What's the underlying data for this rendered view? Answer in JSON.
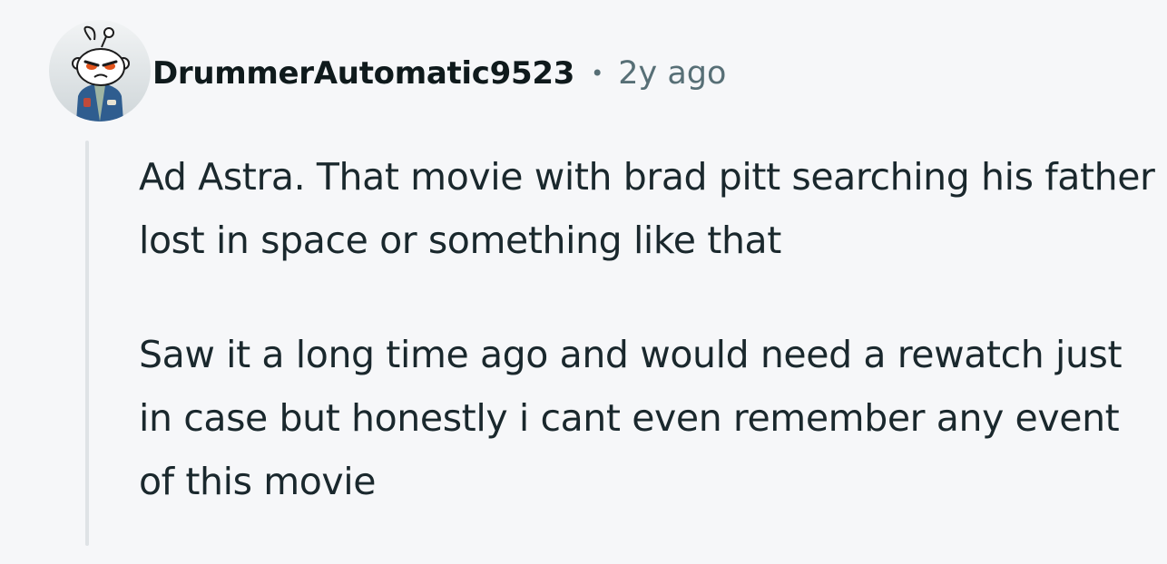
{
  "comment": {
    "username": "DrummerAutomatic9523",
    "separator": "•",
    "timestamp": "2y ago",
    "avatar_icon": "snoo-avatar-icon",
    "paragraphs": [
      "Ad Astra. That movie with brad pitt searching his father lost in space or something like that",
      "Saw it a long time ago and would need a rewatch just in case but honestly i cant even remember any event of this movie"
    ]
  },
  "colors": {
    "background": "#f6f7f9",
    "username": "#0f1a1c",
    "meta": "#576f76",
    "body_text": "#1a282d",
    "thread_line": "#dfe3e6"
  }
}
